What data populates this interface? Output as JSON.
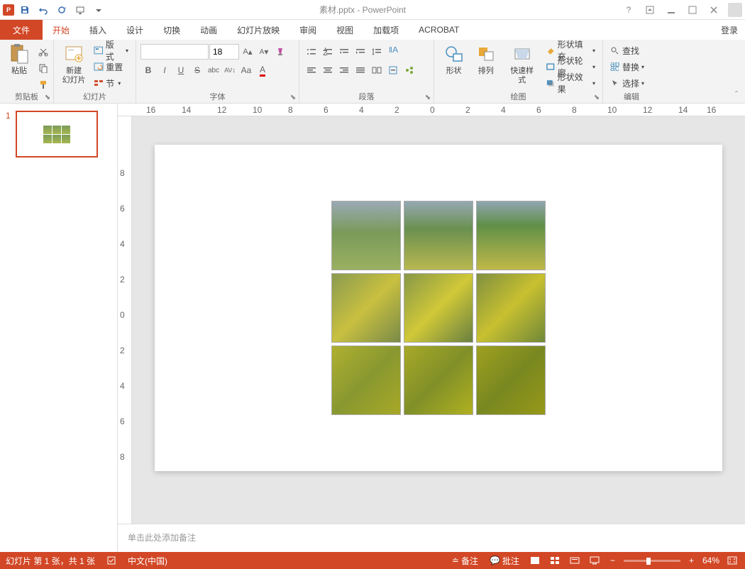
{
  "title": "素材.pptx - PowerPoint",
  "tabs": {
    "file": "文件",
    "home": "开始",
    "insert": "插入",
    "design": "设计",
    "transitions": "切换",
    "animations": "动画",
    "slideshow": "幻灯片放映",
    "review": "审阅",
    "view": "视图",
    "addins": "加载项",
    "acrobat": "ACROBAT"
  },
  "login": "登录",
  "clipboard": {
    "label": "剪贴板",
    "paste": "粘贴"
  },
  "slides": {
    "label": "幻灯片",
    "new": "新建\n幻灯片",
    "layout": "版式",
    "reset": "重置",
    "section": "节"
  },
  "font": {
    "label": "字体",
    "size": "18"
  },
  "paragraph": {
    "label": "段落"
  },
  "drawing": {
    "label": "绘图",
    "shape": "形状",
    "arrange": "排列",
    "quick": "快速样式",
    "fill": "形状填充",
    "outline": "形状轮廓",
    "effects": "形状效果"
  },
  "editing": {
    "label": "编辑",
    "find": "查找",
    "replace": "替换",
    "select": "选择"
  },
  "ruler_h": [
    "16",
    "14",
    "12",
    "10",
    "8",
    "6",
    "4",
    "2",
    "0",
    "2",
    "4",
    "6",
    "8",
    "10",
    "12",
    "14",
    "16"
  ],
  "ruler_v": [
    "8",
    "6",
    "4",
    "2",
    "0",
    "2",
    "4",
    "6",
    "8"
  ],
  "thumb_num": "1",
  "notes": "单击此处添加备注",
  "status": {
    "slide": "幻灯片 第 1 张，共 1 张",
    "lang": "中文(中国)",
    "notes": "备注",
    "comments": "批注",
    "zoom": "64%"
  }
}
